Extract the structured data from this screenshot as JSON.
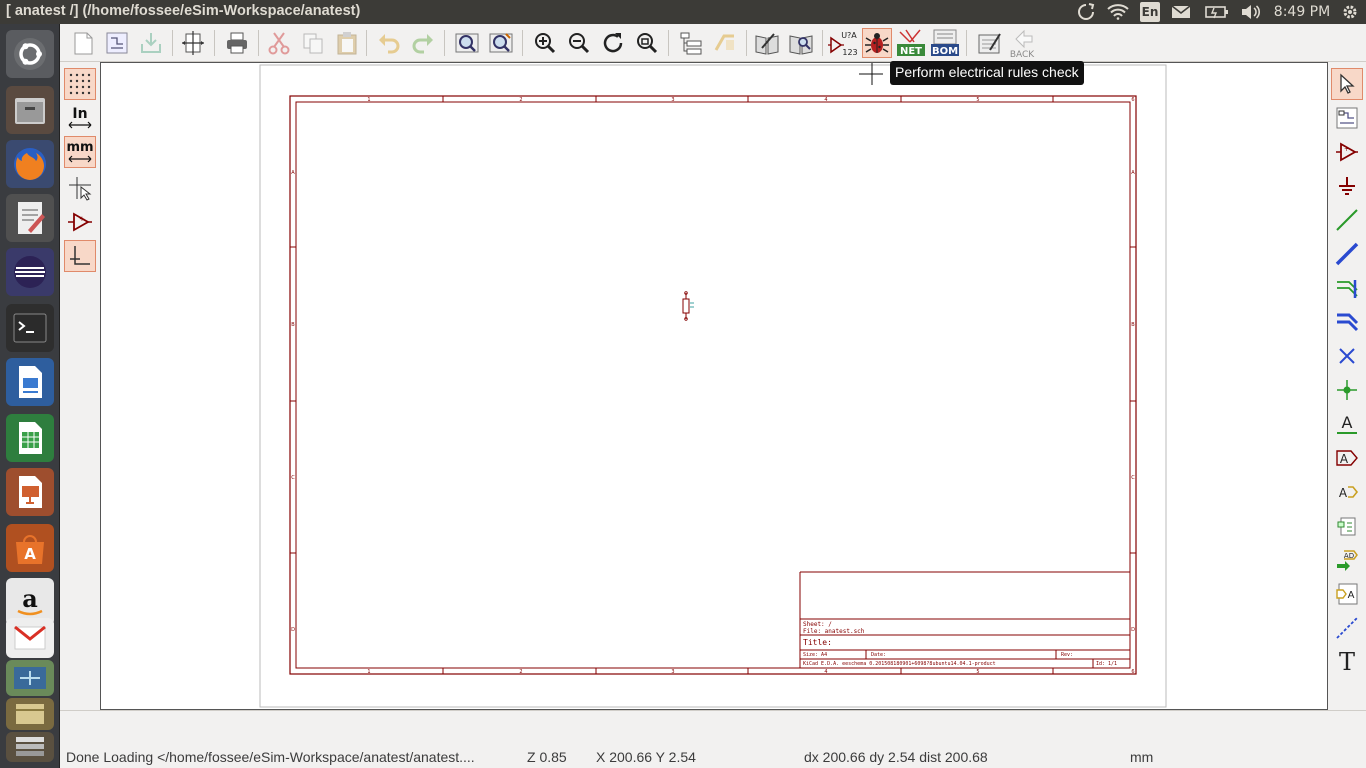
{
  "window": {
    "title": "[ anatest /] (/home/fossee/eSim-Workspace/anatest)"
  },
  "panel": {
    "keyboard": "En",
    "clock": "8:49 PM"
  },
  "launcher": {
    "items": [
      "dash-home",
      "files",
      "firefox",
      "text-editor",
      "eclipse",
      "terminal",
      "writer",
      "calc",
      "impress",
      "software-center",
      "amazon",
      "gmail",
      "mail",
      "kicad",
      "stacked-apps"
    ]
  },
  "toolbar": {
    "annotate_label": "U?A\n123",
    "netlist_label": "NET",
    "bom_label": "BOM",
    "back_label": "BACK"
  },
  "tooltip": {
    "text": "Perform electrical rules check"
  },
  "left_tools": {
    "inch_label": "In",
    "mm_label": "mm"
  },
  "right_tools": {
    "text_label": "T",
    "label_glyph": "A",
    "hier_label_glyph": "A",
    "global_label_glyph": "A"
  },
  "title_block": {
    "sheet": "Sheet: /",
    "file": "File: anatest.sch",
    "title": "Title:",
    "size": "Size: A4",
    "date": "Date:",
    "rev": "Rev:",
    "kicad": "KiCad E.D.A.  eeschema 0.201508180901+6098?8ubuntu14.04.1-product",
    "id": "Id: 1/1"
  },
  "frame": {
    "col_labels": [
      "1",
      "2",
      "3",
      "4",
      "5",
      "6"
    ],
    "row_labels": [
      "A",
      "B",
      "C",
      "D"
    ]
  },
  "status": {
    "message": "Done Loading </home/fossee/eSim-Workspace/anatest/anatest....",
    "zoom": "Z 0.85",
    "coords": "X 200.66  Y 2.54",
    "delta": "dx 200.66  dy 2.54  dist 200.68",
    "units": "mm"
  },
  "colors": {
    "accent": "#e95420",
    "sheet_border": "#840000",
    "component": "#840000",
    "pin": "#008484"
  }
}
